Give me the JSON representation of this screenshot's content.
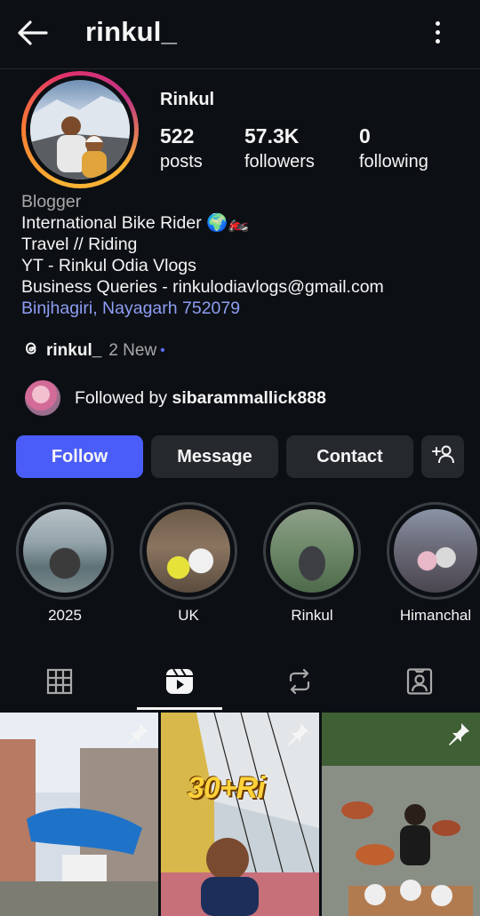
{
  "header": {
    "username": "rinkul_",
    "back_icon": "arrow-left-icon",
    "menu_icon": "more-vertical-icon"
  },
  "profile": {
    "display_name": "Rinkul",
    "stats": [
      {
        "value": "522",
        "label": "posts"
      },
      {
        "value": "57.3K",
        "label": "followers"
      },
      {
        "value": "0",
        "label": "following"
      }
    ],
    "bio": {
      "category": "Blogger",
      "lines": [
        "International Bike Rider 🌍🏍️",
        "Travel // Riding",
        "YT - Rinkul Odia Vlogs",
        "Business Queries - rinkulodiavlogs@gmail.com"
      ],
      "location": "Binjhagiri, Nayagarh 752079"
    },
    "threads": {
      "handle": "rinkul_",
      "new_label": "2 New",
      "dot": "•"
    },
    "followed_by": {
      "prefix": "Followed by ",
      "user": "sibarammallick888"
    }
  },
  "actions": {
    "follow": "Follow",
    "message": "Message",
    "contact": "Contact",
    "add_icon": "add-person-icon"
  },
  "highlights": [
    {
      "label": "2025"
    },
    {
      "label": "UK"
    },
    {
      "label": "Rinkul"
    },
    {
      "label": "Himanchal"
    }
  ],
  "tabs": [
    {
      "icon": "grid-icon",
      "active": false
    },
    {
      "icon": "reels-icon",
      "active": true
    },
    {
      "icon": "repost-icon",
      "active": false
    },
    {
      "icon": "tagged-icon",
      "active": false
    }
  ],
  "posts": [
    {
      "pinned": true,
      "overlay_text": ""
    },
    {
      "pinned": true,
      "overlay_text": "30+Ri"
    },
    {
      "pinned": true,
      "overlay_text": ""
    }
  ],
  "colors": {
    "background": "#0c1014",
    "accent": "#4a5df9",
    "link": "#8e9df3",
    "secondary_button": "#25292e"
  }
}
